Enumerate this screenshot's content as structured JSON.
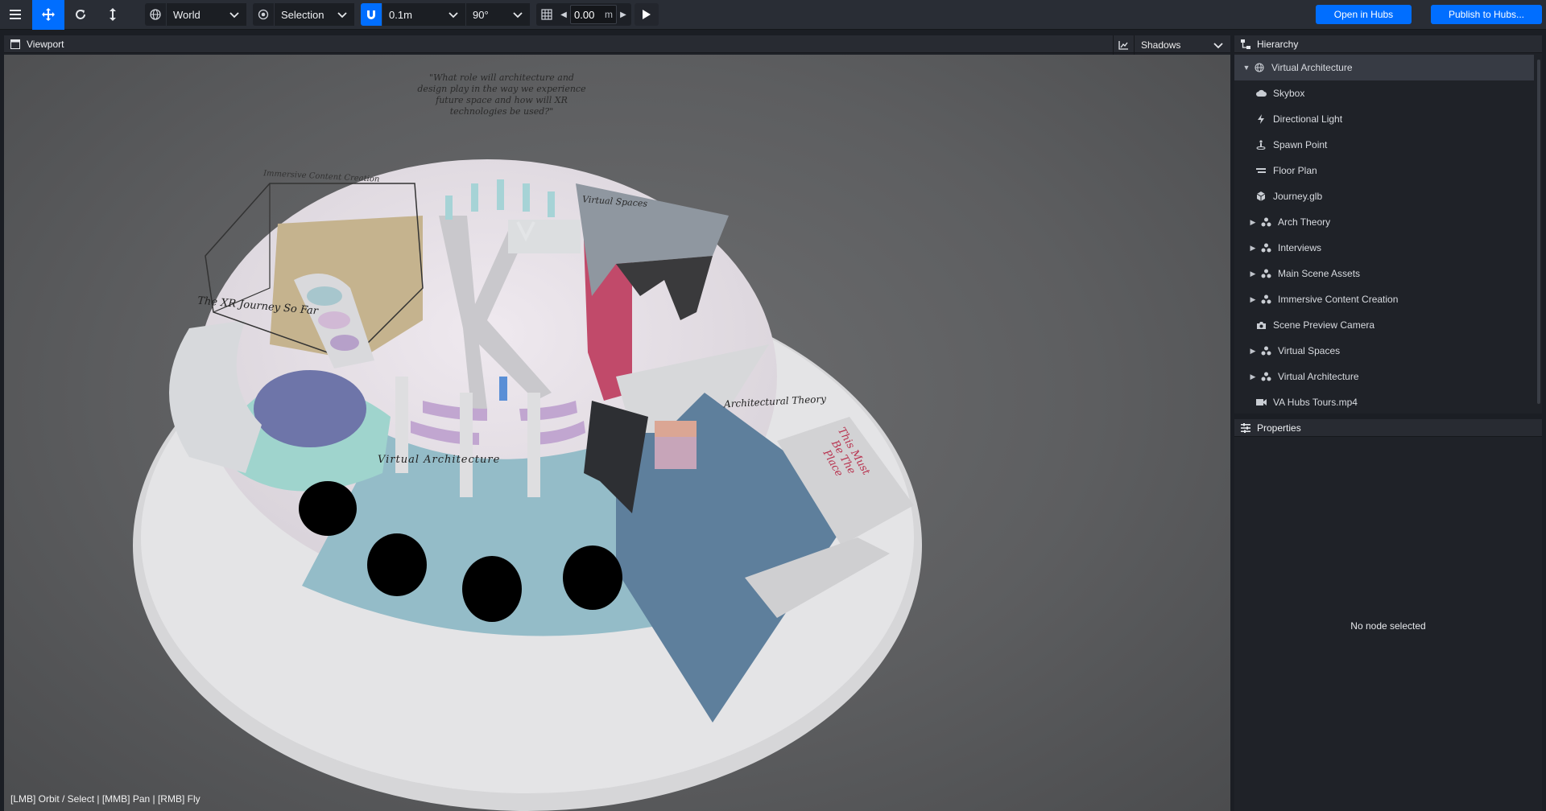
{
  "toolbar": {
    "space": "World",
    "pivot": "Selection",
    "snap_translate": "0.1m",
    "snap_rotate": "90°",
    "grid_height": "0.00",
    "grid_unit": "m",
    "open_in_hubs": "Open in Hubs",
    "publish": "Publish to Hubs..."
  },
  "viewport": {
    "title": "Viewport",
    "shadows": "Shadows",
    "hint": "[LMB] Orbit / Select | [MMB] Pan | [RMB] Fly",
    "scene_labels": {
      "quote": "\"What role will architecture and design play in the way we experience future space and how will XR technologies be used?\"",
      "immersive": "Immersive Content Creation",
      "virtual_spaces": "Virtual Spaces",
      "xr_journey": "The XR Journey So Far",
      "virtual_architecture": "Virtual Architecture",
      "arch_theory": "Architectural Theory",
      "this_must": "This Must Be The Place"
    }
  },
  "hierarchy": {
    "title": "Hierarchy",
    "items": [
      {
        "label": "Virtual Architecture",
        "icon": "globe-icon",
        "toggle": "expanded",
        "indent": 0
      },
      {
        "label": "Skybox",
        "icon": "cloud-icon",
        "toggle": "",
        "indent": 1
      },
      {
        "label": "Directional Light",
        "icon": "bolt-icon",
        "toggle": "",
        "indent": 1
      },
      {
        "label": "Spawn Point",
        "icon": "spawn-icon",
        "toggle": "",
        "indent": 1
      },
      {
        "label": "Floor Plan",
        "icon": "floor-plan-icon",
        "toggle": "",
        "indent": 1
      },
      {
        "label": "Journey.glb",
        "icon": "cube-icon",
        "toggle": "",
        "indent": 1
      },
      {
        "label": "Arch Theory",
        "icon": "group-icon",
        "toggle": "collapsed",
        "indent": 1
      },
      {
        "label": "Interviews",
        "icon": "group-icon",
        "toggle": "collapsed",
        "indent": 1
      },
      {
        "label": "Main Scene Assets",
        "icon": "group-icon",
        "toggle": "collapsed",
        "indent": 1
      },
      {
        "label": "Immersive Content Creation",
        "icon": "group-icon",
        "toggle": "collapsed",
        "indent": 1
      },
      {
        "label": "Scene Preview Camera",
        "icon": "camera-icon",
        "toggle": "",
        "indent": 1
      },
      {
        "label": "Virtual Spaces",
        "icon": "group-icon",
        "toggle": "collapsed",
        "indent": 1
      },
      {
        "label": "Virtual Architecture",
        "icon": "group-icon",
        "toggle": "collapsed",
        "indent": 1
      },
      {
        "label": "VA Hubs Tours.mp4",
        "icon": "video-icon",
        "toggle": "",
        "indent": 1
      }
    ]
  },
  "properties": {
    "title": "Properties",
    "empty": "No node selected"
  },
  "colors": {
    "accent": "#006eff",
    "panel": "#1f2228",
    "toolbar": "#292d35"
  }
}
